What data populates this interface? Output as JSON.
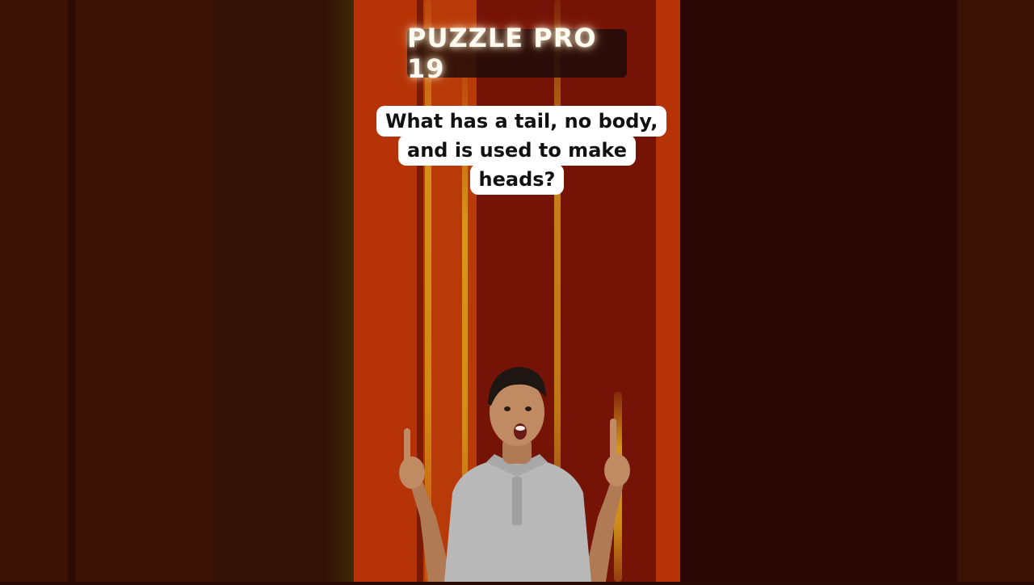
{
  "title": "PUZZLE PRO 19",
  "question": {
    "lines": [
      "What has a tail, no body,",
      "and is used to make",
      "heads?"
    ]
  },
  "colors": {
    "stage_orange": "#b53306",
    "stage_dark_red": "#761307",
    "streak_gold": "#e0a51e",
    "shirt_gray": "#b8b8b8"
  },
  "icons": [
    "pointing-person-illustration"
  ]
}
